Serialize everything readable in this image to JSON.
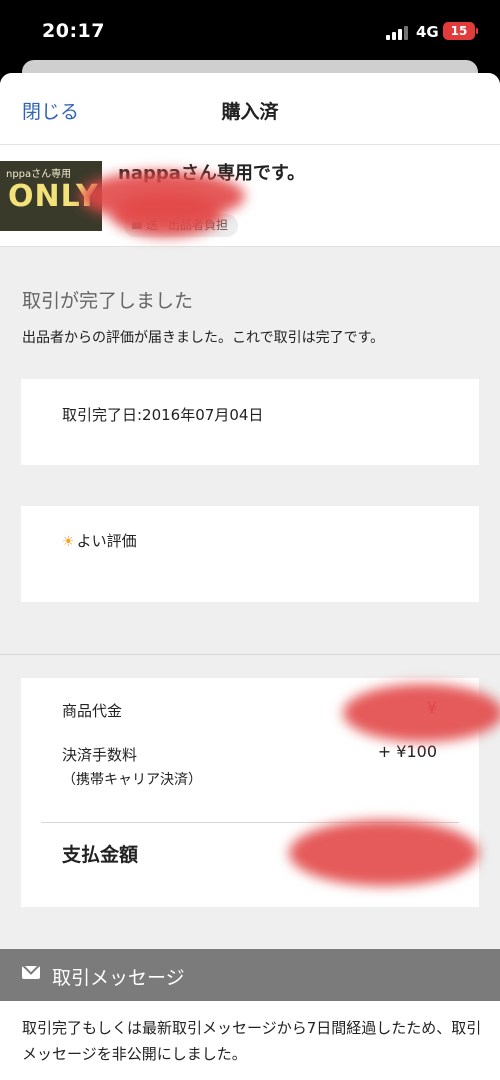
{
  "status_bar": {
    "time": "20:17",
    "network": "4G",
    "battery": "15"
  },
  "nav": {
    "close_label": "閉じる",
    "title": "購入済"
  },
  "item": {
    "thumb_top_text": "nppaさん専用",
    "thumb_big_text": "ONLY",
    "title": "nappaさん専用です。",
    "shipping_chip_prefix": "送",
    "shipping_chip_label": "出品者負担"
  },
  "status": {
    "heading": "取引が完了しました",
    "subtext": "出品者からの評価が届きました。これで取引は完了です。"
  },
  "completion": {
    "text": "取引完了日:2016年07月04日"
  },
  "evaluation": {
    "text": "よい評価"
  },
  "payment": {
    "product_price_label": "商品代金",
    "product_price_value": "¥",
    "fee_label": "決済手数料",
    "fee_value": "+ ¥100",
    "fee_sub": "（携帯キャリア決済）",
    "total_label": "支払金額",
    "total_value": ""
  },
  "messages": {
    "title": "取引メッセージ",
    "body": "取引完了もしくは最新取引メッセージから7日間経過したため、取引メッセージを非公開にしました。"
  },
  "colors": {
    "link": "#2f64b6",
    "redaction": "#e24848",
    "message_bar": "#7b7b7b",
    "battery": "#e23b3b"
  }
}
